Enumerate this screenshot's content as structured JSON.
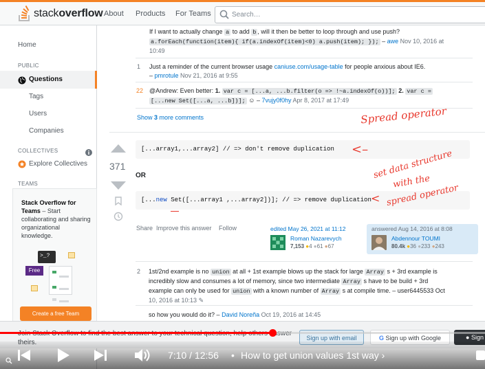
{
  "header": {
    "logo_text_light": "stack",
    "logo_text_bold": "overflow",
    "nav": [
      "About",
      "Products",
      "For Teams"
    ],
    "search_placeholder": "Search…"
  },
  "sidebar": {
    "home": "Home",
    "public_heading": "PUBLIC",
    "questions": "Questions",
    "tags": "Tags",
    "users": "Users",
    "companies": "Companies",
    "collectives_heading": "COLLECTIVES",
    "explore_collectives": "Explore Collectives",
    "teams_heading": "TEAMS",
    "teams_title": "Stack Overflow for Teams",
    "teams_desc": " – Start collaborating and sharing organizational knowledge.",
    "free_badge": "Free",
    "create_team": "Create a free Team"
  },
  "comments_top": [
    {
      "text_a": "If I want to actually change ",
      "code_a": "a",
      "text_b": " to add ",
      "code_b": "b",
      "text_c": ", will it then be better to loop through and use push?",
      "code_long": "a.forEach(function(item){ if(a.indexOf(item)<0) a.push(item); });",
      "author": "awe",
      "date": "Nov 10, 2016 at",
      "date2": "10:49"
    },
    {
      "score": "1",
      "text": "Just a reminder of the current browser usage ",
      "link": "caniuse.com/usage-table",
      "text2": " for people anxious about IE6.",
      "author": "pmrotule",
      "date": "Nov 21, 2016 at 9:55"
    },
    {
      "score": "22",
      "text": "@Andrew: Even better: ",
      "n1": "1.",
      "code1": "var c = [...a, ...b.filter(o => !~a.indexOf(o))];",
      "n2": "2.",
      "code2": "var c =",
      "code3": "[...new Set([...a, ...b])];",
      "emoji": "☺",
      "author": "7vujy0f0hy",
      "date": "Apr 8, 2017 at 17:49"
    }
  ],
  "show_more": {
    "pre": "Show ",
    "count": "3",
    "post": " more comments"
  },
  "answer": {
    "votes": "371",
    "code1": "[...array1,...array2] //   =>  don't remove duplication",
    "or": "OR",
    "code2_pre": "[...",
    "code2_kw": "new",
    "code2_post": " Set([...array1 ,...array2])]; //   => remove duplication",
    "actions": [
      "Share",
      "Improve this answer",
      "Follow"
    ],
    "edited": "edited May 26, 2021 at 11:12",
    "editor": "Roman Nazarevych",
    "editor_rep": "7,153",
    "editor_badges": [
      "4",
      "61",
      "67"
    ],
    "answered": "answered Aug 14, 2016 at 8:08",
    "author": "Abdennour TOUMI",
    "author_rep": "80.4k",
    "author_badges": [
      "36",
      "233",
      "243"
    ]
  },
  "comments_bottom": [
    {
      "score": "2",
      "t1": "1st/2nd example is no ",
      "c1": "union",
      "t2": " at all + 1st example blows up the stack for large ",
      "c2": "Array",
      "t3": " s + 3rd example is",
      "t4": "incredibly slow and consumes a lot of memory, since two intermediate ",
      "c3": "Array",
      "t5": " s have to be build + 3rd",
      "t6": "example can only be used for ",
      "c4": "union",
      "t7": " with a known number of ",
      "c5": "Array",
      "t8": " s at compile time. – user6445533 Oct",
      "t9": "10, 2016 at 10:13"
    },
    {
      "text": "so how you would do it? – ",
      "author": "David Noreña",
      "date": " Oct 19, 2016 at 14:45"
    }
  ],
  "annotations": {
    "spread": "Spread operator",
    "set_line1": "set data structure",
    "set_line2": "with the",
    "set_line3": "spread operator"
  },
  "signup_bar": {
    "text": "Join Stack Overflow to find the best answer to your technical question, help others answer theirs.",
    "email_btn": "Sign up with email",
    "google_btn": "Sign up with Google",
    "github_btn": "Sign"
  },
  "player": {
    "progress": 0.561,
    "time": "7:10 / 12:56",
    "bullet": "•",
    "chapter": "How to get union values 1st way",
    "accent": "#ff0000"
  }
}
